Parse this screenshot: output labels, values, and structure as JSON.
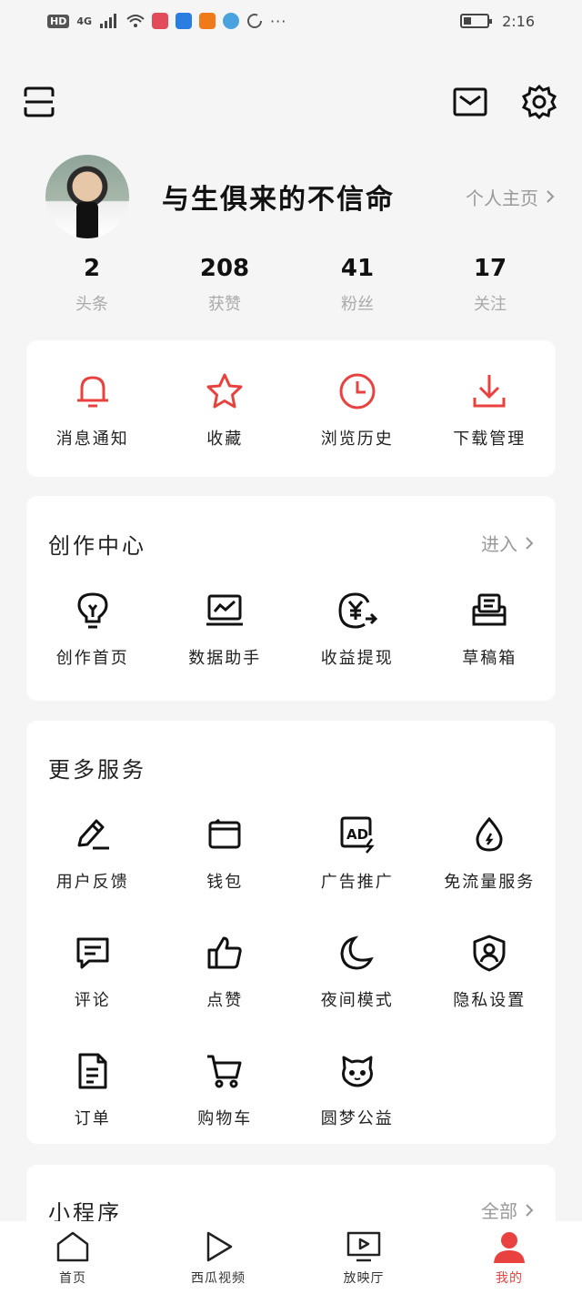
{
  "status_bar": {
    "hd": "HD",
    "signal": "4G",
    "time": "2:16"
  },
  "colors": {
    "accent": "#e8413f",
    "background": "#f5f5f5",
    "card": "#ffffff"
  },
  "header": {
    "scan_icon": "scan-icon",
    "mail_icon": "mail-icon",
    "settings_icon": "gear-icon"
  },
  "profile": {
    "username": "与生俱来的不信命",
    "homepage_link": "个人主页",
    "stats": [
      {
        "value": "2",
        "label": "头条"
      },
      {
        "value": "208",
        "label": "获赞"
      },
      {
        "value": "41",
        "label": "粉丝"
      },
      {
        "value": "17",
        "label": "关注"
      }
    ]
  },
  "quick_actions": [
    {
      "label": "消息通知",
      "icon": "bell-icon"
    },
    {
      "label": "收藏",
      "icon": "star-icon"
    },
    {
      "label": "浏览历史",
      "icon": "clock-icon"
    },
    {
      "label": "下载管理",
      "icon": "download-icon"
    }
  ],
  "creator_center": {
    "title": "创作中心",
    "more": "进入",
    "items": [
      {
        "label": "创作首页",
        "icon": "lightbulb-icon"
      },
      {
        "label": "数据助手",
        "icon": "chart-icon"
      },
      {
        "label": "收益提现",
        "icon": "yuan-icon"
      },
      {
        "label": "草稿箱",
        "icon": "drafts-icon"
      }
    ]
  },
  "more_services": {
    "title": "更多服务",
    "items": [
      {
        "label": "用户反馈",
        "icon": "pencil-icon"
      },
      {
        "label": "钱包",
        "icon": "wallet-icon"
      },
      {
        "label": "广告推广",
        "icon": "ad-icon"
      },
      {
        "label": "免流量服务",
        "icon": "drop-icon"
      },
      {
        "label": "评论",
        "icon": "comment-icon"
      },
      {
        "label": "点赞",
        "icon": "thumbs-up-icon"
      },
      {
        "label": "夜间模式",
        "icon": "moon-icon"
      },
      {
        "label": "隐私设置",
        "icon": "shield-user-icon"
      },
      {
        "label": "订单",
        "icon": "document-icon"
      },
      {
        "label": "购物车",
        "icon": "cart-icon"
      },
      {
        "label": "圆梦公益",
        "icon": "cat-icon"
      }
    ]
  },
  "mini_programs": {
    "title": "小程序",
    "more": "全部"
  },
  "tabbar": [
    {
      "label": "首页",
      "icon": "home-icon",
      "active": false
    },
    {
      "label": "西瓜视频",
      "icon": "play-icon",
      "active": false
    },
    {
      "label": "放映厅",
      "icon": "tv-play-icon",
      "active": false
    },
    {
      "label": "我的",
      "icon": "user-icon",
      "active": true
    }
  ]
}
